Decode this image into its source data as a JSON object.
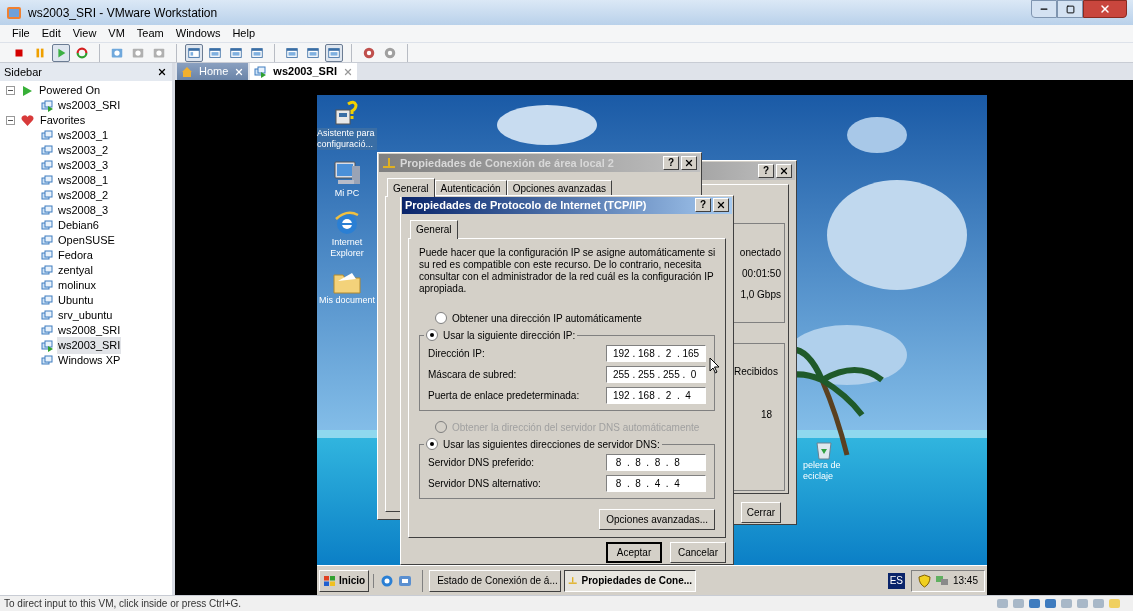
{
  "window": {
    "title": "ws2003_SRI - VMware Workstation"
  },
  "menu": [
    "File",
    "Edit",
    "View",
    "VM",
    "Team",
    "Windows",
    "Help"
  ],
  "toolbar": [
    [
      {
        "kind": "stop",
        "pressed": false
      },
      {
        "kind": "pause",
        "pressed": false
      },
      {
        "kind": "play",
        "pressed": true
      },
      {
        "kind": "reset",
        "pressed": false
      }
    ],
    [
      {
        "kind": "snapshot",
        "pressed": false
      },
      {
        "kind": "revert",
        "pressed": false
      },
      {
        "kind": "manager",
        "pressed": false
      }
    ],
    [
      {
        "kind": "sidebar",
        "pressed": true
      },
      {
        "kind": "fullscreen",
        "pressed": false
      },
      {
        "kind": "console",
        "pressed": false
      },
      {
        "kind": "unity",
        "pressed": false
      }
    ],
    [
      {
        "kind": "summary",
        "pressed": false
      },
      {
        "kind": "appliance",
        "pressed": false
      },
      {
        "kind": "switch",
        "pressed": true
      }
    ],
    [
      {
        "kind": "share",
        "pressed": false
      },
      {
        "kind": "share2",
        "pressed": false
      }
    ]
  ],
  "sidebar": {
    "title": "Sidebar",
    "groups": [
      {
        "label": "Powered On",
        "kind": "power",
        "expanded": true,
        "children": [
          {
            "label": "ws2003_SRI",
            "running": true,
            "selected": false
          }
        ]
      },
      {
        "label": "Favorites",
        "kind": "favorites",
        "expanded": true,
        "children": [
          {
            "label": "ws2003_1",
            "running": false,
            "selected": false
          },
          {
            "label": "ws2003_2",
            "running": false,
            "selected": false
          },
          {
            "label": "ws2003_3",
            "running": false,
            "selected": false
          },
          {
            "label": "ws2008_1",
            "running": false,
            "selected": false
          },
          {
            "label": "ws2008_2",
            "running": false,
            "selected": false
          },
          {
            "label": "ws2008_3",
            "running": false,
            "selected": false
          },
          {
            "label": "Debian6",
            "running": false,
            "selected": false
          },
          {
            "label": "OpenSUSE",
            "running": false,
            "selected": false
          },
          {
            "label": "Fedora",
            "running": false,
            "selected": false
          },
          {
            "label": "zentyal",
            "running": false,
            "selected": false
          },
          {
            "label": "molinux",
            "running": false,
            "selected": false
          },
          {
            "label": "Ubuntu",
            "running": false,
            "selected": false
          },
          {
            "label": "srv_ubuntu",
            "running": false,
            "selected": false
          },
          {
            "label": "ws2008_SRI",
            "running": false,
            "selected": false
          },
          {
            "label": "ws2003_SRI",
            "running": true,
            "selected": true
          },
          {
            "label": "Windows XP",
            "running": false,
            "selected": false
          }
        ]
      }
    ]
  },
  "vm_tabs": [
    {
      "label": "Home",
      "kind": "home",
      "selected": false
    },
    {
      "label": "ws2003_SRI",
      "kind": "vm",
      "selected": true
    }
  ],
  "guest": {
    "desktop_icons": [
      {
        "kind": "wizard",
        "label": "Asistente para configuració..."
      },
      {
        "kind": "computer",
        "label": "Mi PC"
      },
      {
        "kind": "browser",
        "label": "Internet Explorer"
      },
      {
        "kind": "documents",
        "label": "Mis document"
      }
    ],
    "recycle_bin": {
      "lines": [
        "pelera de",
        "eciclaje"
      ]
    },
    "status_dialog": {
      "active": false,
      "help": "?",
      "values": [
        "onectado",
        "00:01:50",
        "1,0 Gbps"
      ],
      "received_label": "Recibidos",
      "received_value": "18",
      "close_button": "Cerrar"
    },
    "lan_dialog": {
      "active": false,
      "title": "Propiedades de Conexión de área local 2",
      "help": "?",
      "tabs": [
        {
          "label": "General",
          "selected": true
        },
        {
          "label": "Autenticación",
          "selected": false
        },
        {
          "label": "Opciones avanzadas",
          "selected": false
        }
      ]
    },
    "tcpip_dialog": {
      "active": true,
      "title": "Propiedades de Protocolo de Internet (TCP/IP)",
      "help": "?",
      "tabs": [
        {
          "label": "General",
          "selected": true
        }
      ],
      "intro": "Puede hacer que la configuración IP se asigne automáticamente si su red es compatible con este recurso. De lo contrario, necesita consultar con el administrador de la red cuál es la configuración IP apropiada.",
      "ip_auto": {
        "label": "Obtener una dirección IP automáticamente",
        "selected": false,
        "disabled": false
      },
      "ip_manual": {
        "label": "Usar la siguiente dirección IP:",
        "selected": true,
        "disabled": false
      },
      "ip_fields": [
        {
          "label": "Dirección IP:",
          "value": "192 . 168 .  2  . 165"
        },
        {
          "label": "Máscara de subred:",
          "value": "255 . 255 . 255 .  0"
        },
        {
          "label": "Puerta de enlace predeterminada:",
          "value": "192 . 168 .  2  .  4"
        }
      ],
      "dns_auto": {
        "label": "Obtener la dirección del servidor DNS automáticamente",
        "selected": false,
        "disabled": true
      },
      "dns_manual": {
        "label": "Usar las siguientes direcciones de servidor DNS:",
        "selected": true,
        "disabled": false
      },
      "dns_fields": [
        {
          "label": "Servidor DNS preferido:",
          "value": " 8  .  8  .  8  .  8"
        },
        {
          "label": "Servidor DNS alternativo:",
          "value": " 8  .  8  .  4  .  4"
        }
      ],
      "advanced_button": "Opciones avanzadas...",
      "ok_button": "Aceptar",
      "cancel_button": "Cancelar"
    },
    "taskbar": {
      "start": "Inicio",
      "tasks": [
        {
          "label": "Estado de Conexión de á...",
          "selected": false
        },
        {
          "label": "Propiedades de Cone...",
          "selected": true
        }
      ],
      "language": "ES",
      "clock": "13:45"
    }
  },
  "status_bar": {
    "hint": "To direct input to this VM, click inside or press Ctrl+G."
  }
}
